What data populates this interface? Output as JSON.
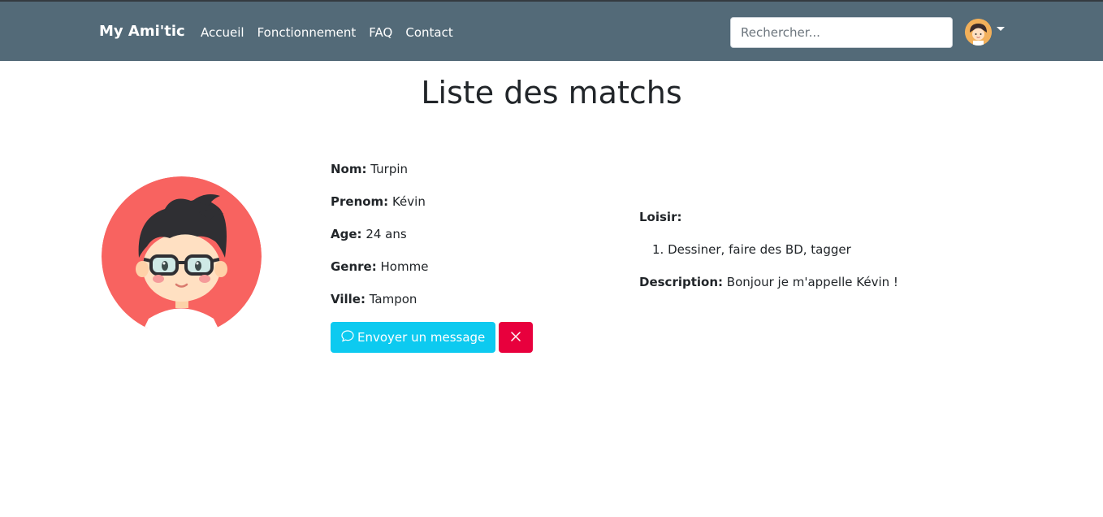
{
  "navbar": {
    "brand": "My Ami'tic",
    "links": [
      "Accueil",
      "Fonctionnement",
      "FAQ",
      "Contact"
    ],
    "search_placeholder": "Rechercher...",
    "avatar_icon": "user-avatar-icon",
    "menu_icon": "caret-down-icon",
    "background": "#536a78"
  },
  "page": {
    "title": "Liste des matchs"
  },
  "match": {
    "avatar_icon": "boy-with-glasses-avatar",
    "fields": [
      {
        "label": "Nom:",
        "value": "Turpin"
      },
      {
        "label": "Prenom:",
        "value": "Kévin"
      },
      {
        "label": "Age:",
        "value": "24 ans"
      },
      {
        "label": "Genre:",
        "value": "Homme"
      },
      {
        "label": "Ville:",
        "value": "Tampon"
      }
    ],
    "message_button": "Envoyer un message",
    "message_icon": "chat-bubble-icon",
    "delete_icon": "close-icon",
    "hobbies_label": "Loisir:",
    "hobbies": [
      "1. Dessiner, faire des BD, tagger"
    ],
    "description_label": "Description:",
    "description": "Bonjour je m'appelle Kévin !"
  },
  "colors": {
    "info": "#0dcaf0",
    "danger": "#e8003d",
    "avatar_bg": "#f86360"
  }
}
